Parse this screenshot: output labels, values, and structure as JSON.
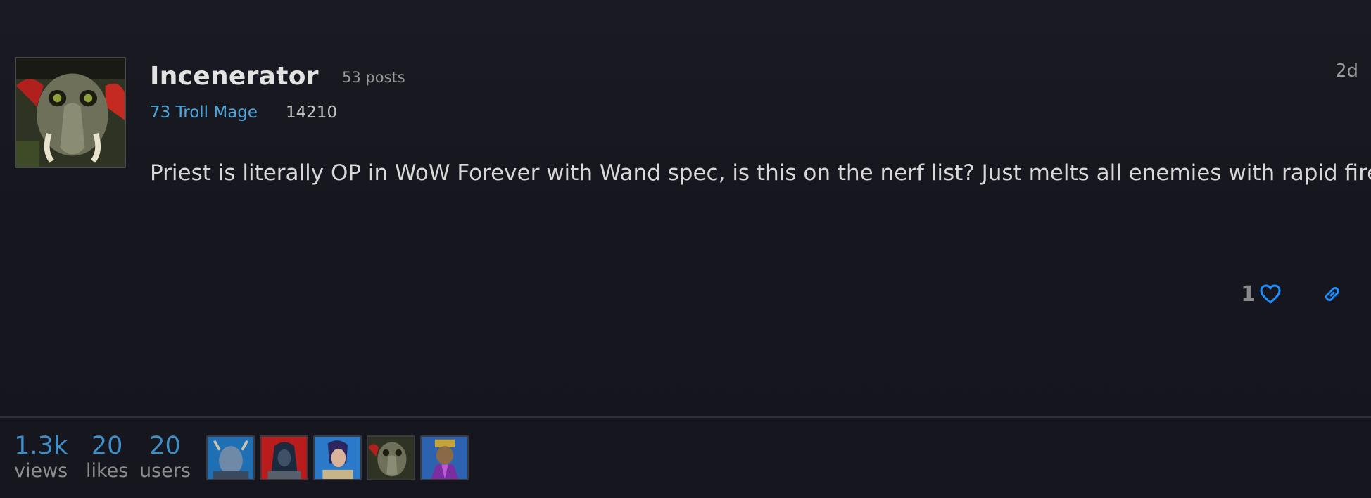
{
  "post": {
    "username": "Incenerator",
    "post_count": "53 posts",
    "character": "73 Troll Mage",
    "achievement_points": "14210",
    "date": "2d",
    "body": "Priest is literally OP in WoW Forever with Wand spec, is this on the nerf list? Just melts all enemies with rapid fire.",
    "like_count": "1",
    "avatar_icon": "troll-portrait-icon"
  },
  "footer": {
    "views": {
      "value": "1.3k",
      "label": "views"
    },
    "likes": {
      "value": "20",
      "label": "likes"
    },
    "users": {
      "value": "20",
      "label": "users"
    },
    "participants": [
      {
        "icon": "draenei-portrait-icon"
      },
      {
        "icon": "undead-portrait-icon"
      },
      {
        "icon": "human-portrait-icon"
      },
      {
        "icon": "troll-portrait-icon"
      },
      {
        "icon": "dwarf-portrait-icon"
      }
    ]
  },
  "colors": {
    "background": "#16161f",
    "link_blue": "#4ea8de",
    "stat_blue": "#3e8fc7",
    "heart_blue": "#1e90ff"
  }
}
